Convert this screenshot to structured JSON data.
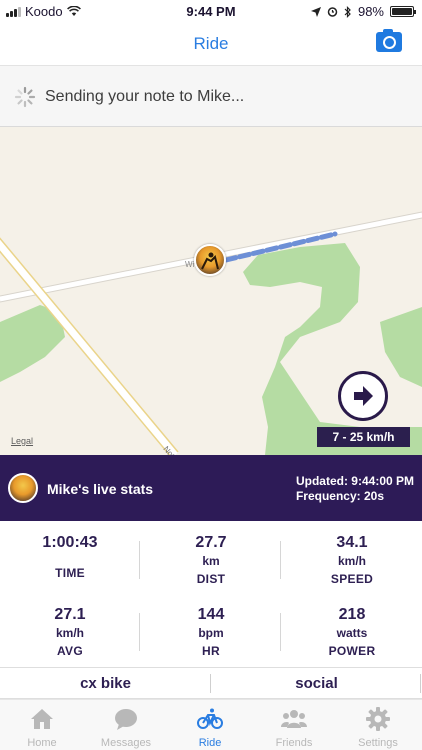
{
  "status_bar": {
    "carrier": "Koodo",
    "time": "9:44 PM",
    "battery": "98%",
    "battery_level": 0.98
  },
  "navbar": {
    "title": "Ride",
    "camera_icon": "camera-icon"
  },
  "banner": {
    "text": "Sending your note to Mike...",
    "icon": "spinner-icon"
  },
  "map": {
    "legal": "Legal",
    "speed_range": "7 - 25 km/h",
    "road_label_1": "Wi",
    "road_label_2": "Notr",
    "colors": {
      "land": "#f5f1e8",
      "park": "#b5dca3",
      "route": "#6d8fd6"
    }
  },
  "live": {
    "label": "Mike's live stats",
    "updated": "Updated: 9:44:00 PM",
    "frequency": "Frequency: 20s",
    "color": "#2d1b57"
  },
  "stats": [
    {
      "value": "1:00:43",
      "unit": "",
      "label": "TIME"
    },
    {
      "value": "27.7",
      "unit": "km",
      "label": "DIST"
    },
    {
      "value": "34.1",
      "unit": "km/h",
      "label": "SPEED"
    },
    {
      "value": "27.1",
      "unit": "km/h",
      "label": "AVG"
    },
    {
      "value": "144",
      "unit": "bpm",
      "label": "HR"
    },
    {
      "value": "218",
      "unit": "watts",
      "label": "POWER"
    }
  ],
  "tags": [
    "cx bike",
    "social"
  ],
  "tabs": [
    {
      "label": "Home",
      "icon": "home-icon"
    },
    {
      "label": "Messages",
      "icon": "messages-icon"
    },
    {
      "label": "Ride",
      "icon": "bike-icon",
      "active": true
    },
    {
      "label": "Friends",
      "icon": "friends-icon"
    },
    {
      "label": "Settings",
      "icon": "settings-icon"
    }
  ]
}
